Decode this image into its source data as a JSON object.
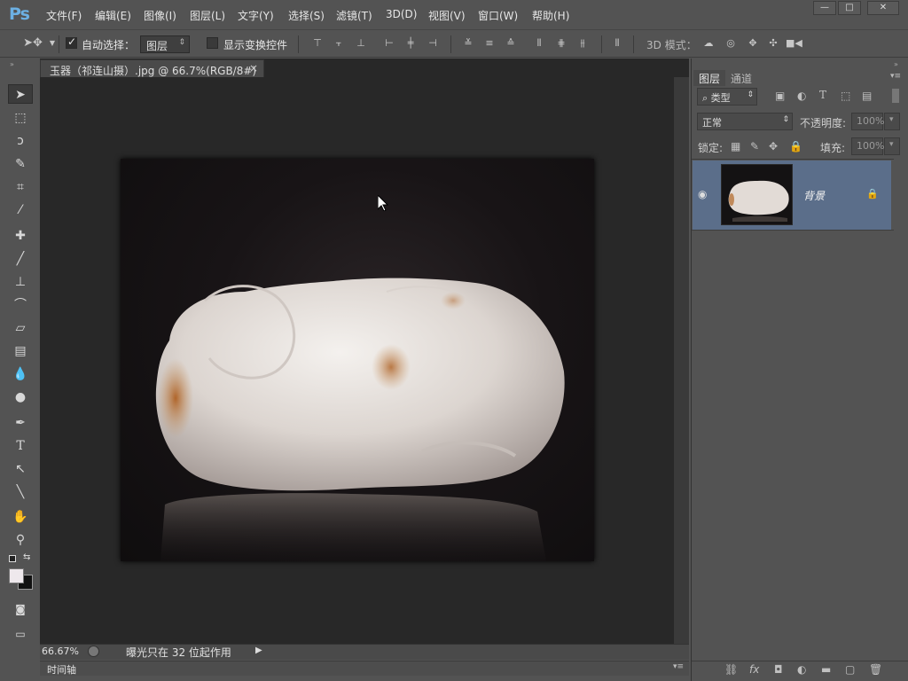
{
  "app": {
    "logo": "Ps"
  },
  "menu": {
    "file": "文件(F)",
    "edit": "编辑(E)",
    "image": "图像(I)",
    "layer": "图层(L)",
    "type": "文字(Y)",
    "select": "选择(S)",
    "filter": "滤镜(T)",
    "3d": "3D(D)",
    "view": "视图(V)",
    "window": "窗口(W)",
    "help": "帮助(H)"
  },
  "window_controls": {
    "minimize": "—",
    "maximize": "□",
    "close": "✕"
  },
  "options": {
    "auto_select_label": "自动选择：",
    "auto_select_checked": true,
    "auto_select_target": "图层",
    "show_transform_label": "显示变换控件",
    "show_transform_checked": false,
    "mode_3d_label": "3D 模式："
  },
  "document": {
    "tab_title": "玉器（祁连山摄）.jpg @ 66.7%(RGB/8#)",
    "tab_close": "×"
  },
  "status": {
    "zoom": "66.67%",
    "message": "曝光只在 32 位起作用"
  },
  "timeline": {
    "label": "时间轴"
  },
  "panels": {
    "tabs": [
      "图层",
      "通道"
    ],
    "filter_kind": "类型",
    "blend_mode": "正常",
    "opacity_label": "不透明度:",
    "opacity_value": "100%",
    "lock_label": "锁定:",
    "fill_label": "填充:",
    "fill_value": "100%",
    "layers": [
      {
        "name": "背景",
        "visible": true,
        "locked": true
      }
    ]
  },
  "colors": {
    "accent": "#5b6e8a",
    "app_bg": "#535353",
    "canvas_bg": "#282828",
    "ps_logo": "#6cb0e3"
  }
}
